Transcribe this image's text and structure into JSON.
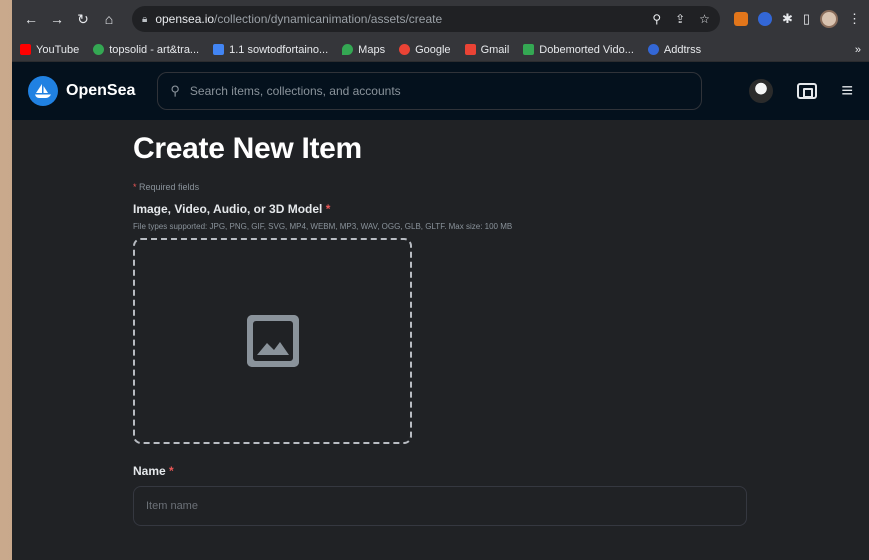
{
  "browser": {
    "url_host": "opensea.io",
    "url_path": "/collection/dynamicanimation/assets/create",
    "bookmarks": [
      {
        "label": "YouTube",
        "color": "#ff0000"
      },
      {
        "label": "topsolid - art&tra...",
        "color": "#34a853"
      },
      {
        "label": "1.1 sowtodfortaino...",
        "color": "#4285f4"
      },
      {
        "label": "Maps",
        "color": "#34a853"
      },
      {
        "label": "Google",
        "color": "#ea4335"
      },
      {
        "label": "Gmail",
        "color": "#ea4335"
      },
      {
        "label": "Dobemorted Vido...",
        "color": "#34a853"
      },
      {
        "label": "Addtrss",
        "color": "#3367d6"
      }
    ],
    "bookmarks_more": "»"
  },
  "header": {
    "brand": "OpenSea",
    "search_placeholder": "Search items, collections, and accounts"
  },
  "form": {
    "title": "Create New Item",
    "required_note": "Required fields",
    "media_label": "Image, Video, Audio, or 3D Model",
    "media_help": "File types supported: JPG, PNG, GIF, SVG, MP4, WEBM, MP3, WAV, OGG, GLB, GLTF. Max size: 100 MB",
    "name_label": "Name",
    "name_placeholder": "Item name",
    "required_mark": "*"
  },
  "colors": {
    "accent": "#2081e2",
    "required": "#eb5757",
    "header_bg": "#04111d",
    "page_bg": "#202225"
  }
}
